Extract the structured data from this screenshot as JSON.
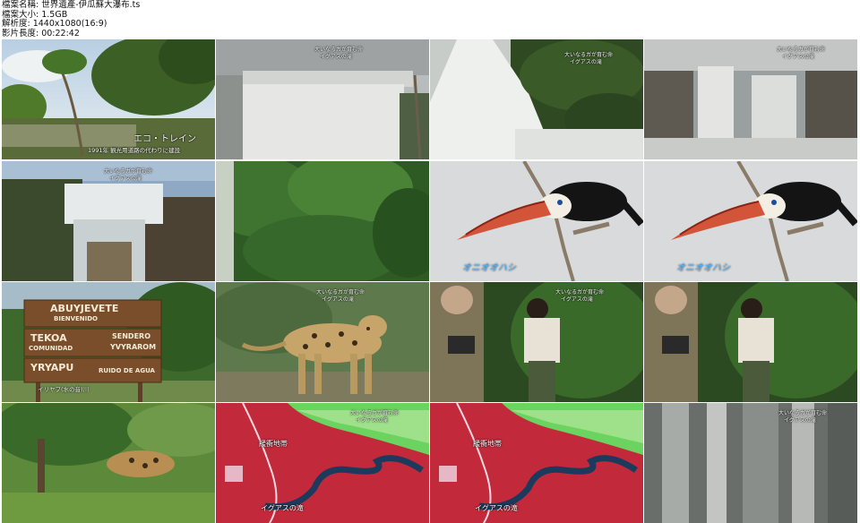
{
  "header": {
    "file_name": "檔案名稱: 世界遺產-伊瓜蘇大瀑布.ts",
    "file_size": "檔案大小: 1.5GB",
    "resolution": "解析度: 1440x1080(16:9)",
    "duration": "影片長度: 00:22:42"
  },
  "tiles": [
    {
      "id": 1,
      "caption": "エコ・トレイン",
      "subcaption": "1991年 観光用道路の代わりに建設"
    },
    {
      "id": 2,
      "lines": [
        "大いなるガが育む命",
        "イグアスの滝"
      ]
    },
    {
      "id": 3,
      "lines": [
        "大いなるガが育む命",
        "イグアスの滝"
      ]
    },
    {
      "id": 4,
      "lines": [
        "大いなるガが育む命",
        "イグアスの滝"
      ]
    },
    {
      "id": 5,
      "lines": [
        "大いなるガが育む命",
        "イグアスの滝"
      ]
    },
    {
      "id": 6
    },
    {
      "id": 7,
      "label": "オニオオハシ"
    },
    {
      "id": 8,
      "label": "オニオオハシ"
    },
    {
      "id": 9,
      "sign": [
        "ABUYJEVETE",
        "BIENVENIDO",
        "TEKOA",
        "COMUNIDAD",
        "SENDERO",
        "YVYRAROM",
        "YRYAPU",
        "RUIDO DE AGUA"
      ],
      "caption": "イリヤプ(水の音)川"
    },
    {
      "id": 10,
      "lines": [
        "大いなるガが育む命",
        "イグアスの滝"
      ]
    },
    {
      "id": 11,
      "lines": [
        "大いなるガが育む命",
        "イグアスの滝"
      ]
    },
    {
      "id": 12
    },
    {
      "id": 13
    },
    {
      "id": 14,
      "label_top": "緩衝地帯",
      "label_bottom": "イグアスの滝",
      "lines": [
        "大いなるガが育む命",
        "イグアスの滝"
      ]
    },
    {
      "id": 15,
      "label_top": "緩衝地帯",
      "label_bottom": "イグアスの滝"
    },
    {
      "id": 16,
      "lines": [
        "大いなるガが育む命",
        "イグアスの滝"
      ]
    }
  ],
  "colors": {
    "background": "#ffffff",
    "label_blue": "#4fb6ff",
    "map_red": "#c22a3c",
    "map_green": "#6bd35f",
    "river": "#1d3a5c"
  }
}
